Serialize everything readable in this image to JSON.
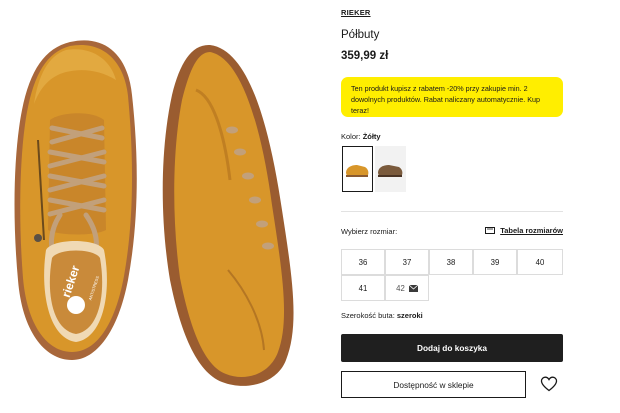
{
  "product": {
    "brand": "RIEKER",
    "title": "Półbuty",
    "price": "359,99 zł",
    "promo_text": "Ten produkt kupisz z rabatem -20% przy zakupie min. 2 dowolnych produktów. Rabat naliczany automatycznie. Kup teraz!",
    "image_logo_text": "rieker",
    "image_logo_subtext": "ANTISTRESS"
  },
  "color": {
    "label": "Kolor:",
    "value": "Żółty",
    "swatches": [
      {
        "name": "yellow",
        "hex": "#d89a2c",
        "selected": true
      },
      {
        "name": "brown",
        "hex": "#7a5a3c",
        "selected": false
      }
    ]
  },
  "size": {
    "label": "Wybierz rozmiar:",
    "table_link": "Tabela rozmiarów",
    "options": [
      {
        "value": "36",
        "available": true
      },
      {
        "value": "37",
        "available": true
      },
      {
        "value": "38",
        "available": true
      },
      {
        "value": "39",
        "available": true
      },
      {
        "value": "40",
        "available": true
      },
      {
        "value": "41",
        "available": true
      },
      {
        "value": "42",
        "available": false,
        "icon": "mail-icon"
      }
    ]
  },
  "width": {
    "label": "Szerokość buta:",
    "value": "szeroki"
  },
  "actions": {
    "add_to_cart": "Dodaj do koszyka",
    "store_availability": "Dostępność w sklepie",
    "wishlist_icon": "heart-icon"
  },
  "colors": {
    "accent_promo": "#ffee00",
    "button_dark": "#1f1f1f",
    "shoe": "#d89a2c",
    "sole": "#a8673a"
  }
}
